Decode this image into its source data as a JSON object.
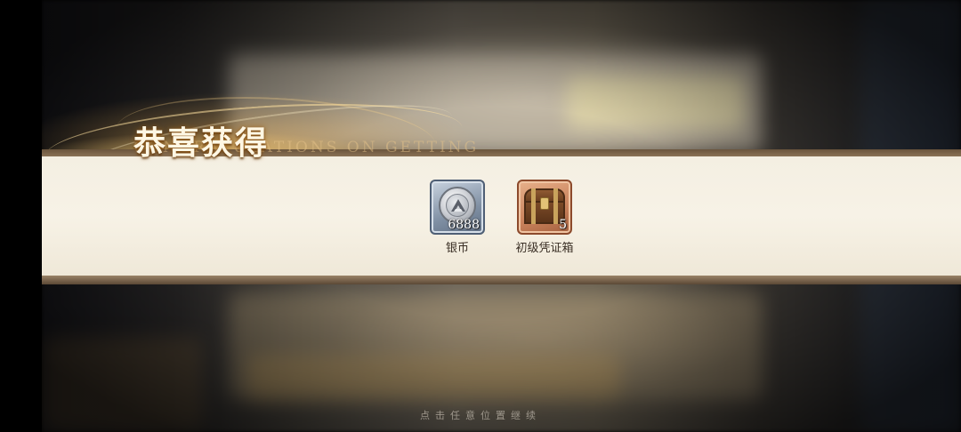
{
  "header": {
    "title": "恭喜获得",
    "subtitle": "CONGRATULATIONS ON GETTING"
  },
  "rewards": [
    {
      "name": "银币",
      "count": "6888",
      "icon": "silver-coin-icon",
      "frame_color": "#7f8fa3"
    },
    {
      "name": "初级凭证箱",
      "count": "5",
      "icon": "treasure-chest-icon",
      "frame_color": "#c9825c"
    }
  ],
  "footer": {
    "hint": "点击任意位置继续"
  },
  "colors": {
    "banner": "#f6f1e4",
    "title": "#fff7e4",
    "glow": "#ffc864"
  }
}
